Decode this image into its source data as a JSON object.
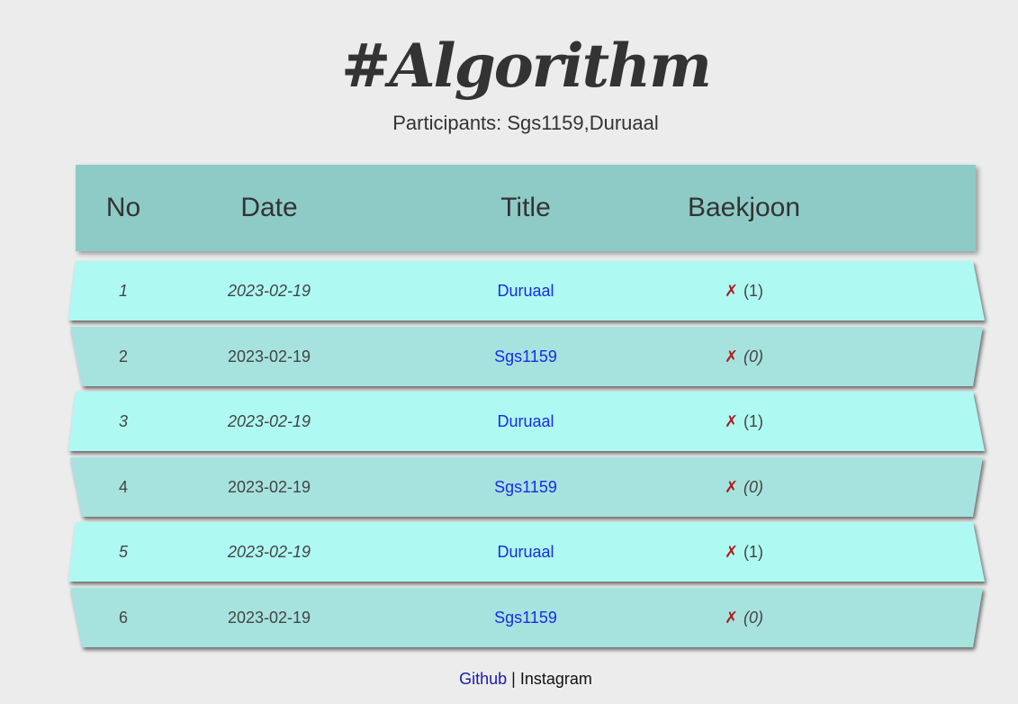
{
  "page": {
    "title": "#Algorithm",
    "participants": "Participants: Sgs1159,Duruaal"
  },
  "table": {
    "headers": {
      "no": "No",
      "date": "Date",
      "title": "Title",
      "baekjoon": "Baekjoon"
    },
    "rows": [
      {
        "no": "1",
        "date": "2023-02-19",
        "title": "Duruaal",
        "mark": "✗",
        "count": "(1)"
      },
      {
        "no": "2",
        "date": "2023-02-19",
        "title": "Sgs1159",
        "mark": "✗",
        "count": "(0)"
      },
      {
        "no": "3",
        "date": "2023-02-19",
        "title": "Duruaal",
        "mark": "✗",
        "count": "(1)"
      },
      {
        "no": "4",
        "date": "2023-02-19",
        "title": "Sgs1159",
        "mark": "✗",
        "count": "(0)"
      },
      {
        "no": "5",
        "date": "2023-02-19",
        "title": "Duruaal",
        "mark": "✗",
        "count": "(1)"
      },
      {
        "no": "6",
        "date": "2023-02-19",
        "title": "Sgs1159",
        "mark": "✗",
        "count": "(0)"
      }
    ]
  },
  "footer": {
    "github": "Github",
    "separator": "|",
    "instagram": "Instagram"
  },
  "colors": {
    "background": "#ececec",
    "header_bg": "#8ecbc6",
    "row_odd_bg": "#aefaf2",
    "row_even_bg": "#a6e3df",
    "link": "#1a2be0",
    "fail_mark": "#b01e1e"
  }
}
